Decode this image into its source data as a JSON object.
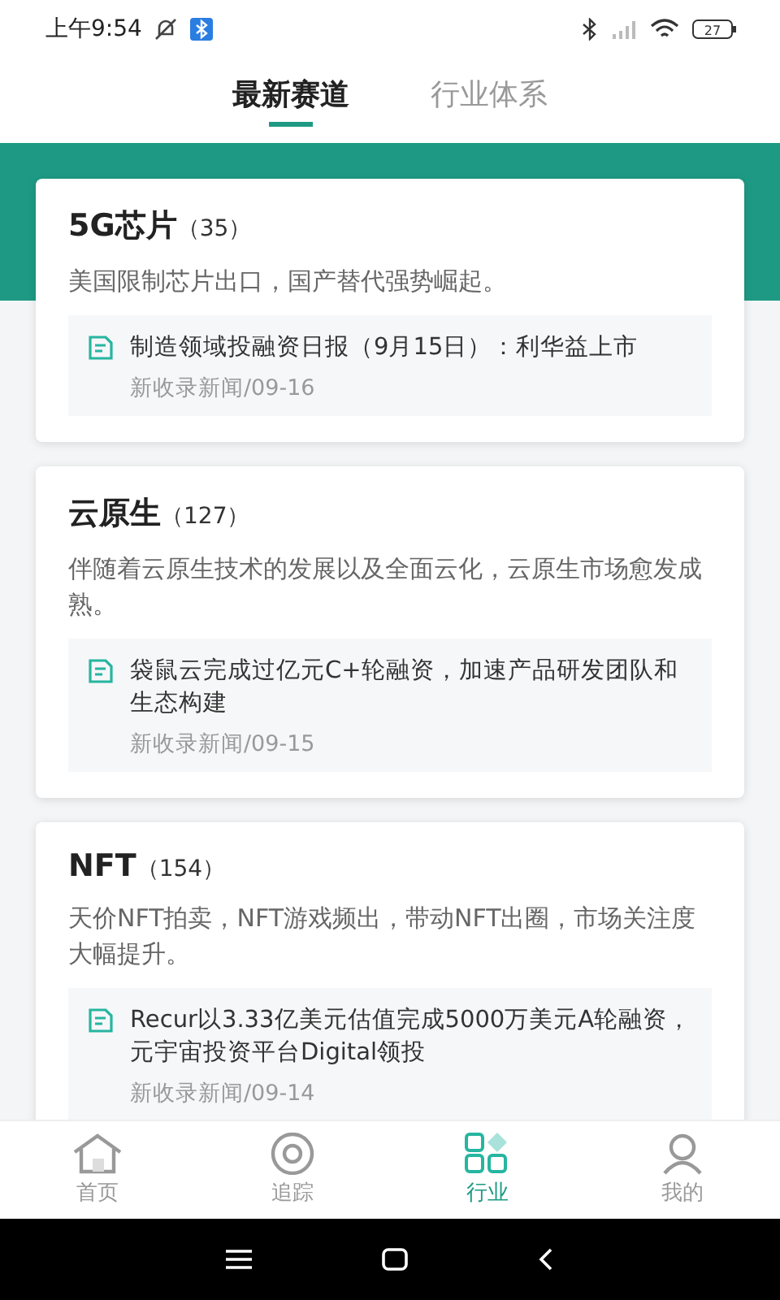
{
  "status_bar": {
    "time": "上午9:54",
    "battery": "27"
  },
  "tabs": [
    {
      "label": "最新赛道",
      "selected": true
    },
    {
      "label": "行业体系",
      "selected": false
    }
  ],
  "cards": [
    {
      "title": "5G芯片",
      "count": "（35）",
      "description": "美国限制芯片出口，国产替代强势崛起。",
      "news": {
        "title": "制造领域投融资日报（9月15日）：利华益上市",
        "meta": "新收录新闻/09-16"
      }
    },
    {
      "title": "云原生",
      "count": "（127）",
      "description": "伴随着云原生技术的发展以及全面云化，云原生市场愈发成熟。",
      "news": {
        "title": "袋鼠云完成过亿元C+轮融资，加速产品研发团队和生态构建",
        "meta": "新收录新闻/09-15"
      }
    },
    {
      "title": "NFT",
      "count": "（154）",
      "description": "天价NFT拍卖，NFT游戏频出，带动NFT出圈，市场关注度大幅提升。",
      "news": {
        "title": "Recur以3.33亿美元估值完成5000万美元A轮融资，元宇宙投资平台Digital领投",
        "meta": "新收录新闻/09-14"
      }
    }
  ],
  "bottom_nav": [
    {
      "kind": "home",
      "label": "首页",
      "selected": false
    },
    {
      "kind": "track",
      "label": "追踪",
      "selected": false
    },
    {
      "kind": "industry",
      "label": "行业",
      "selected": true
    },
    {
      "kind": "profile",
      "label": "我的",
      "selected": false
    }
  ]
}
